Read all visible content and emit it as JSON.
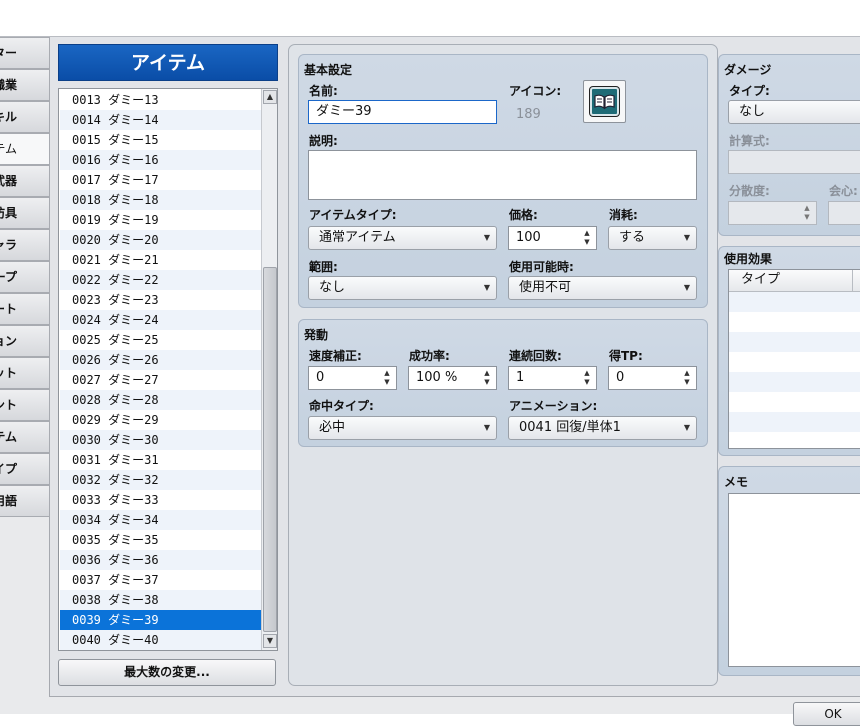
{
  "tabs": [
    {
      "label": "アクター"
    },
    {
      "label": "職業"
    },
    {
      "label": "スキル"
    },
    {
      "label": "アイテム"
    },
    {
      "label": "武器"
    },
    {
      "label": "防具"
    },
    {
      "label": "敵キャラ"
    },
    {
      "label": "敵グループ"
    },
    {
      "label": "ステート"
    },
    {
      "label": "アニメーション"
    },
    {
      "label": "タイルセット"
    },
    {
      "label": "コモンイベント"
    },
    {
      "label": "システム"
    },
    {
      "label": "タイプ"
    },
    {
      "label": "用語"
    }
  ],
  "list": {
    "title": "アイテム",
    "items": [
      "0013 ダミー13",
      "0014 ダミー14",
      "0015 ダミー15",
      "0016 ダミー16",
      "0017 ダミー17",
      "0018 ダミー18",
      "0019 ダミー19",
      "0020 ダミー20",
      "0021 ダミー21",
      "0022 ダミー22",
      "0023 ダミー23",
      "0024 ダミー24",
      "0025 ダミー25",
      "0026 ダミー26",
      "0027 ダミー27",
      "0028 ダミー28",
      "0029 ダミー29",
      "0030 ダミー30",
      "0031 ダミー31",
      "0032 ダミー32",
      "0033 ダミー33",
      "0034 ダミー34",
      "0035 ダミー35",
      "0036 ダミー36",
      "0037 ダミー37",
      "0038 ダミー38",
      "0039 ダミー39",
      "0040 ダミー40"
    ],
    "selected_index": 26,
    "max_button": "最大数の変更..."
  },
  "basic": {
    "title": "基本設定",
    "name_label": "名前:",
    "name_value": "ダミー39",
    "icon_label": "アイコン:",
    "icon_index": "189",
    "icon_name": "book-icon",
    "desc_label": "説明:",
    "desc_value": "",
    "item_type_label": "アイテムタイプ:",
    "item_type_value": "通常アイテム",
    "price_label": "価格:",
    "price_value": "100",
    "consume_label": "消耗:",
    "consume_value": "する",
    "scope_label": "範囲:",
    "scope_value": "なし",
    "occasion_label": "使用可能時:",
    "occasion_value": "使用不可"
  },
  "invocation": {
    "title": "発動",
    "speed_label": "速度補正:",
    "speed_value": "0",
    "success_label": "成功率:",
    "success_value": "100 %",
    "repeat_label": "連続回数:",
    "repeat_value": "1",
    "tp_label": "得TP:",
    "tp_value": "0",
    "hit_type_label": "命中タイプ:",
    "hit_type_value": "必中",
    "animation_label": "アニメーション:",
    "animation_value": "0041 回復/単体1"
  },
  "damage": {
    "title": "ダメージ",
    "type_label": "タイプ:",
    "type_value": "なし",
    "formula_label": "計算式:",
    "variance_label": "分散度:",
    "critical_label": "会心:"
  },
  "effects": {
    "title": "使用効果",
    "col_type": "タイプ"
  },
  "memo": {
    "title": "メモ"
  },
  "ok_button": "OK"
}
